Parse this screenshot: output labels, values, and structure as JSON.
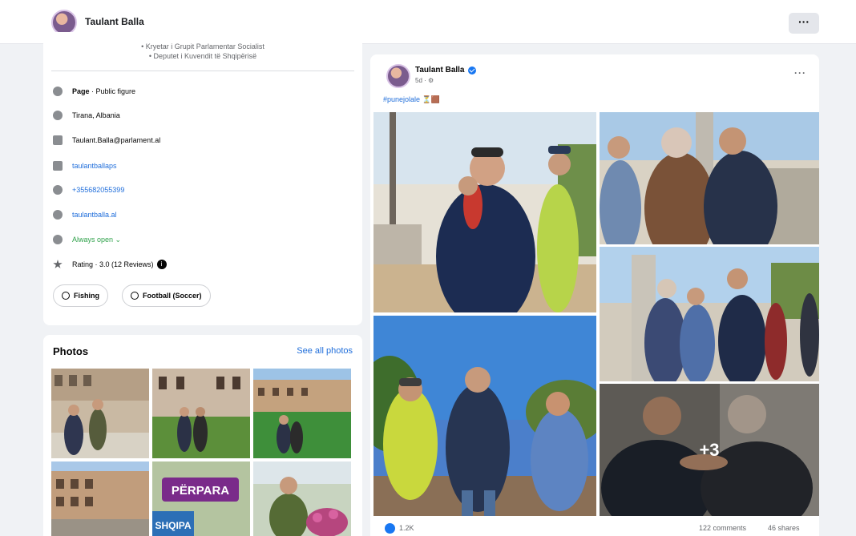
{
  "header": {
    "name": "Taulant Balla",
    "more_label": "···"
  },
  "intro": {
    "bio_lines": [
      "• Kryetar i Grupit Parlamentar Socialist",
      "• Deputet i Kuvendit të Shqipërisë"
    ],
    "details": [
      {
        "icon": "info-icon",
        "prefix": "Page",
        "text": " · Public figure"
      },
      {
        "icon": "location-icon",
        "text": "Tirana, Albania"
      },
      {
        "icon": "email-icon",
        "text": "Taulant.Balla@parlament.al"
      },
      {
        "icon": "instagram-icon",
        "text": "taulantballaps"
      },
      {
        "icon": "whatsapp-icon",
        "text": "+355682055399"
      },
      {
        "icon": "website-icon",
        "text": "taulantballa.al"
      },
      {
        "icon": "clock-icon",
        "text": "Always open ⌄"
      },
      {
        "icon": "star-icon",
        "text": "Rating · 3.0 (12 Reviews)",
        "badge": "i"
      }
    ],
    "chips": [
      "Fishing",
      "Football (Soccer)"
    ]
  },
  "photos": {
    "title": "Photos",
    "see_all": "See all photos",
    "banner_text": "PËRPARA",
    "sign_text": "SHQIPA"
  },
  "post": {
    "author": "Taulant Balla",
    "time": "5d · ⚙",
    "hashtag": "#punejolale",
    "emoji": "⏳🟫",
    "more_label": "···",
    "overlay_count": "+3",
    "likes": "1.2K",
    "comments": "122 comments",
    "shares": "46 shares"
  },
  "colors": {
    "link": "#216fdb",
    "accent": "#1877f2",
    "background": "#f0f2f5"
  }
}
